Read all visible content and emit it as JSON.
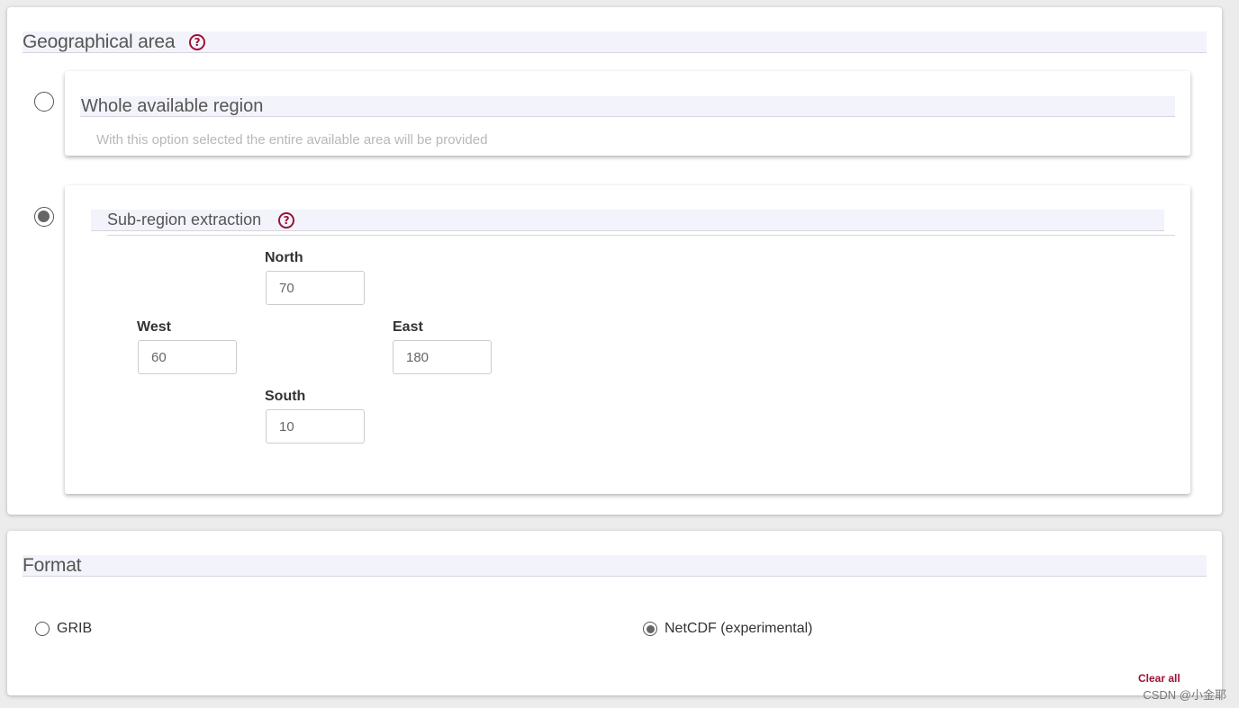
{
  "geo": {
    "title": "Geographical area",
    "help_glyph": "?",
    "whole": {
      "title": "Whole available region",
      "description": "With this option selected the entire available area will be provided",
      "selected": false
    },
    "subregion": {
      "title": "Sub-region extraction",
      "selected": true,
      "north": {
        "label": "North",
        "value": "70"
      },
      "west": {
        "label": "West",
        "value": "60"
      },
      "east": {
        "label": "East",
        "value": "180"
      },
      "south": {
        "label": "South",
        "value": "10"
      }
    }
  },
  "format": {
    "title": "Format",
    "options": [
      {
        "label": "GRIB",
        "selected": false
      },
      {
        "label": "NetCDF (experimental)",
        "selected": true
      }
    ],
    "clear_all": "Clear all"
  },
  "watermark": "CSDN @小金耶",
  "colors": {
    "accent": "#9b1236",
    "header_bg": "#f3f3fb"
  },
  "icons": {
    "help": "question-circle-icon"
  }
}
